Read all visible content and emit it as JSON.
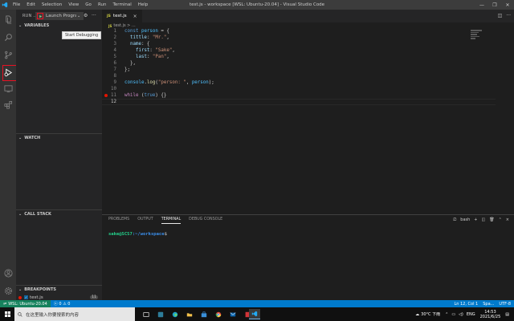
{
  "window": {
    "title": "test.js - workspace [WSL: Ubuntu-20.04] - Visual Studio Code",
    "menu": [
      "File",
      "Edit",
      "Selection",
      "View",
      "Go",
      "Run",
      "Terminal",
      "Help"
    ],
    "controls": {
      "minimize": "—",
      "restore": "❐",
      "close": "✕"
    }
  },
  "activity_bar": {
    "items": [
      "explorer-icon",
      "search-icon",
      "source-control-icon",
      "run-debug-icon",
      "remote-explorer-icon",
      "extensions-icon"
    ],
    "bottom": [
      "account-icon",
      "settings-gear-icon"
    ],
    "active": "run-debug-icon"
  },
  "sidebar": {
    "header": "RUN ...",
    "launch_config": "Launch Program",
    "tooltip": "Start Debugging",
    "sections": {
      "variables": "VARIABLES",
      "watch": "WATCH",
      "call_stack": "CALL STACK",
      "breakpoints": "BREAKPOINTS"
    },
    "breakpoint_file": "test.js",
    "breakpoint_line": "11"
  },
  "editor": {
    "tab_label": "test.js",
    "tab_badge": "JS",
    "breadcrumb": "test.js > ...",
    "lines": [
      {
        "n": "1",
        "text": "const person = {"
      },
      {
        "n": "2",
        "text": "  tittle: \"Mr.\","
      },
      {
        "n": "3",
        "text": "  name: {"
      },
      {
        "n": "4",
        "text": "    first: \"Sake\","
      },
      {
        "n": "5",
        "text": "    last: \"Pan\","
      },
      {
        "n": "6",
        "text": "  },"
      },
      {
        "n": "7",
        "text": "};"
      },
      {
        "n": "8",
        "text": ""
      },
      {
        "n": "9",
        "text": "console.log(\"person: \", person);"
      },
      {
        "n": "10",
        "text": ""
      },
      {
        "n": "11",
        "text": "while (true) {}"
      },
      {
        "n": "12",
        "text": ""
      }
    ],
    "breakpoint_on_line": "11",
    "cursor_line": "12"
  },
  "panel": {
    "tabs": [
      "PROBLEMS",
      "OUTPUT",
      "TERMINAL",
      "DEBUG CONSOLE"
    ],
    "active_tab": "TERMINAL",
    "shell": "bash",
    "prompt_user": "sake@SCS7",
    "prompt_path": ":~/workspace",
    "prompt_symbol": "$"
  },
  "status_bar": {
    "remote": "WSL: Ubuntu-20.04",
    "errors": "0",
    "warnings": "0",
    "position": "Ln 12, Col 1",
    "spaces": "Spa...",
    "encoding": "UTF-8"
  },
  "taskbar": {
    "search_placeholder": "在这里输入你要搜索的内容",
    "weather": "30°C 下雨",
    "lang": "ENG",
    "time": "14:53",
    "date": "2021/6/25"
  }
}
